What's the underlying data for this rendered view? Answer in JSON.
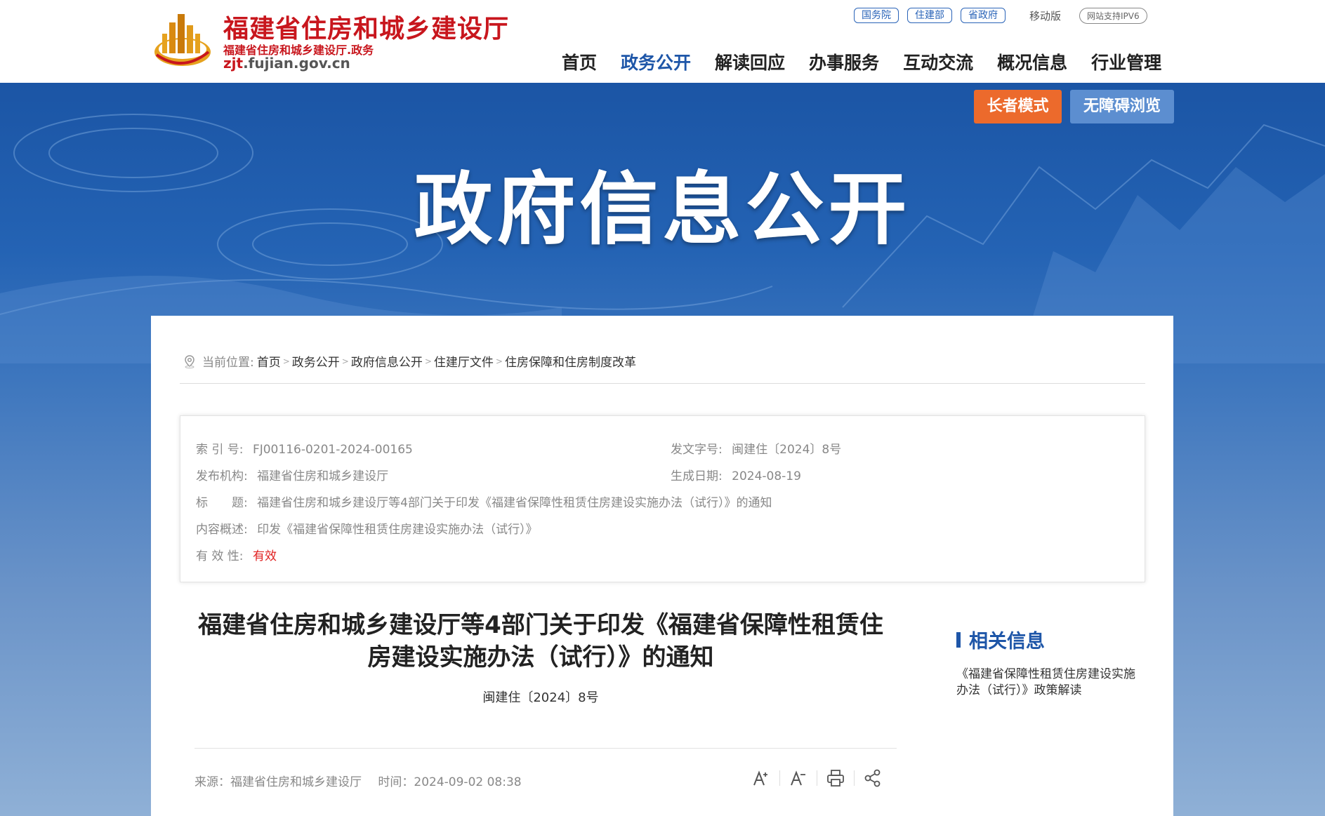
{
  "header": {
    "site_title": "福建省住房和城乡建设厅",
    "site_subtitle": "福建省住房和城乡建设厅.政务",
    "domain_prefix": "zjt",
    "domain_rest": ".fujian.gov.cn",
    "top_links": [
      "国务院",
      "住建部",
      "省政府"
    ],
    "mobile": "移动版",
    "ipv6": "网站支持IPV6",
    "nav": [
      "首页",
      "政务公开",
      "解读回应",
      "办事服务",
      "互动交流",
      "概况信息",
      "行业管理"
    ],
    "active_nav": "政务公开"
  },
  "banner": {
    "title": "政府信息公开",
    "elder_mode": "长者模式",
    "accessible": "无障碍浏览"
  },
  "breadcrumb": {
    "label": "当前位置:",
    "items": [
      "首页",
      "政务公开",
      "政府信息公开",
      "住建厅文件",
      "住房保障和住房制度改革"
    ]
  },
  "meta": {
    "index_label": "索 引 号:",
    "index_value": "FJ00116-0201-2024-00165",
    "doc_number_label": "发文字号:",
    "doc_number_value": "闽建住〔2024〕8号",
    "publisher_label": "发布机构:",
    "publisher_value": "福建省住房和城乡建设厅",
    "date_label": "生成日期:",
    "date_value": "2024-08-19",
    "title_label": "标　　题:",
    "title_value": "福建省住房和城乡建设厅等4部门关于印发《福建省保障性租赁住房建设实施办法（试行）》的通知",
    "summary_label": "内容概述:",
    "summary_value": "印发《福建省保障性租赁住房建设实施办法（试行）》",
    "validity_label": "有 效 性:",
    "validity_value": "有效"
  },
  "document": {
    "title_line1": "福建省住房和城乡建设厅等4部门关于印发《福建省保障性租赁住",
    "title_line2": "房建设实施办法（试行）》的通知",
    "number": "闽建住〔2024〕8号",
    "source": "来源：福建省住房和城乡建设厅",
    "time": "时间：2024-09-02 08:38"
  },
  "related": {
    "heading": "相关信息",
    "link": "《福建省保障性租赁住房建设实施办法（试行）》政策解读"
  },
  "colors": {
    "brand_red": "#c8161d",
    "brand_blue": "#1e56a8",
    "elder_orange": "#ec6a2c",
    "accessible_blue": "#5c8ed0"
  },
  "icons": {
    "location": "location-pin-icon",
    "font_increase": "font-increase-icon",
    "font_decrease": "font-decrease-icon",
    "print": "print-icon",
    "share": "share-icon"
  }
}
